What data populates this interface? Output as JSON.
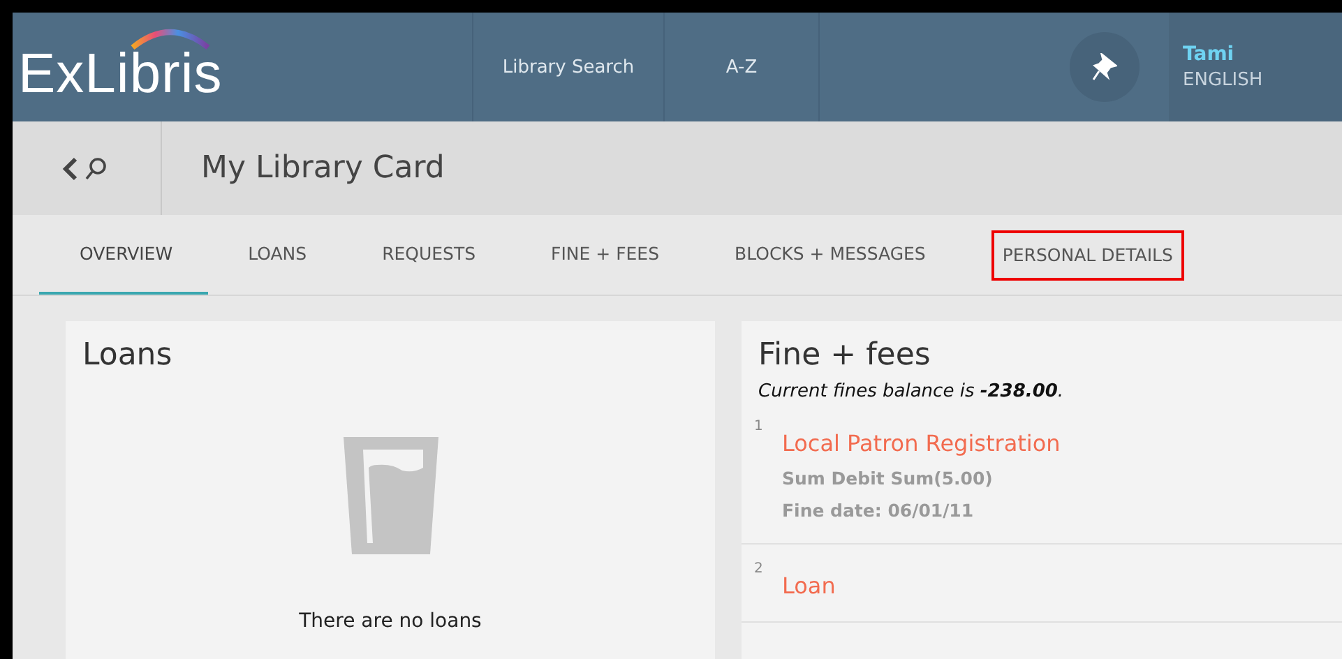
{
  "header": {
    "logo": "ExLibris",
    "nav": [
      "Library Search",
      "A-Z"
    ],
    "user": {
      "name": "Tami",
      "language": "ENGLISH"
    }
  },
  "page": {
    "title": "My Library Card"
  },
  "tabs": [
    {
      "label": "OVERVIEW",
      "selected": true,
      "highlighted": false
    },
    {
      "label": "LOANS",
      "selected": false,
      "highlighted": false
    },
    {
      "label": "REQUESTS",
      "selected": false,
      "highlighted": false
    },
    {
      "label": "FINE + FEES",
      "selected": false,
      "highlighted": false
    },
    {
      "label": "BLOCKS + MESSAGES",
      "selected": false,
      "highlighted": false
    },
    {
      "label": "PERSONAL DETAILS",
      "selected": false,
      "highlighted": true
    }
  ],
  "loans": {
    "title": "Loans",
    "empty_message": "There are no loans"
  },
  "fines": {
    "title": "Fine + fees",
    "balance": "Current fines balance is **-238.00**.",
    "items": [
      {
        "number": "1",
        "title": "Local Patron Registration",
        "lines": [
          "Sum Debit Sum(5.00)",
          "Fine date: 06/01/11"
        ]
      },
      {
        "number": "2",
        "title": "Loan"
      }
    ]
  }
}
